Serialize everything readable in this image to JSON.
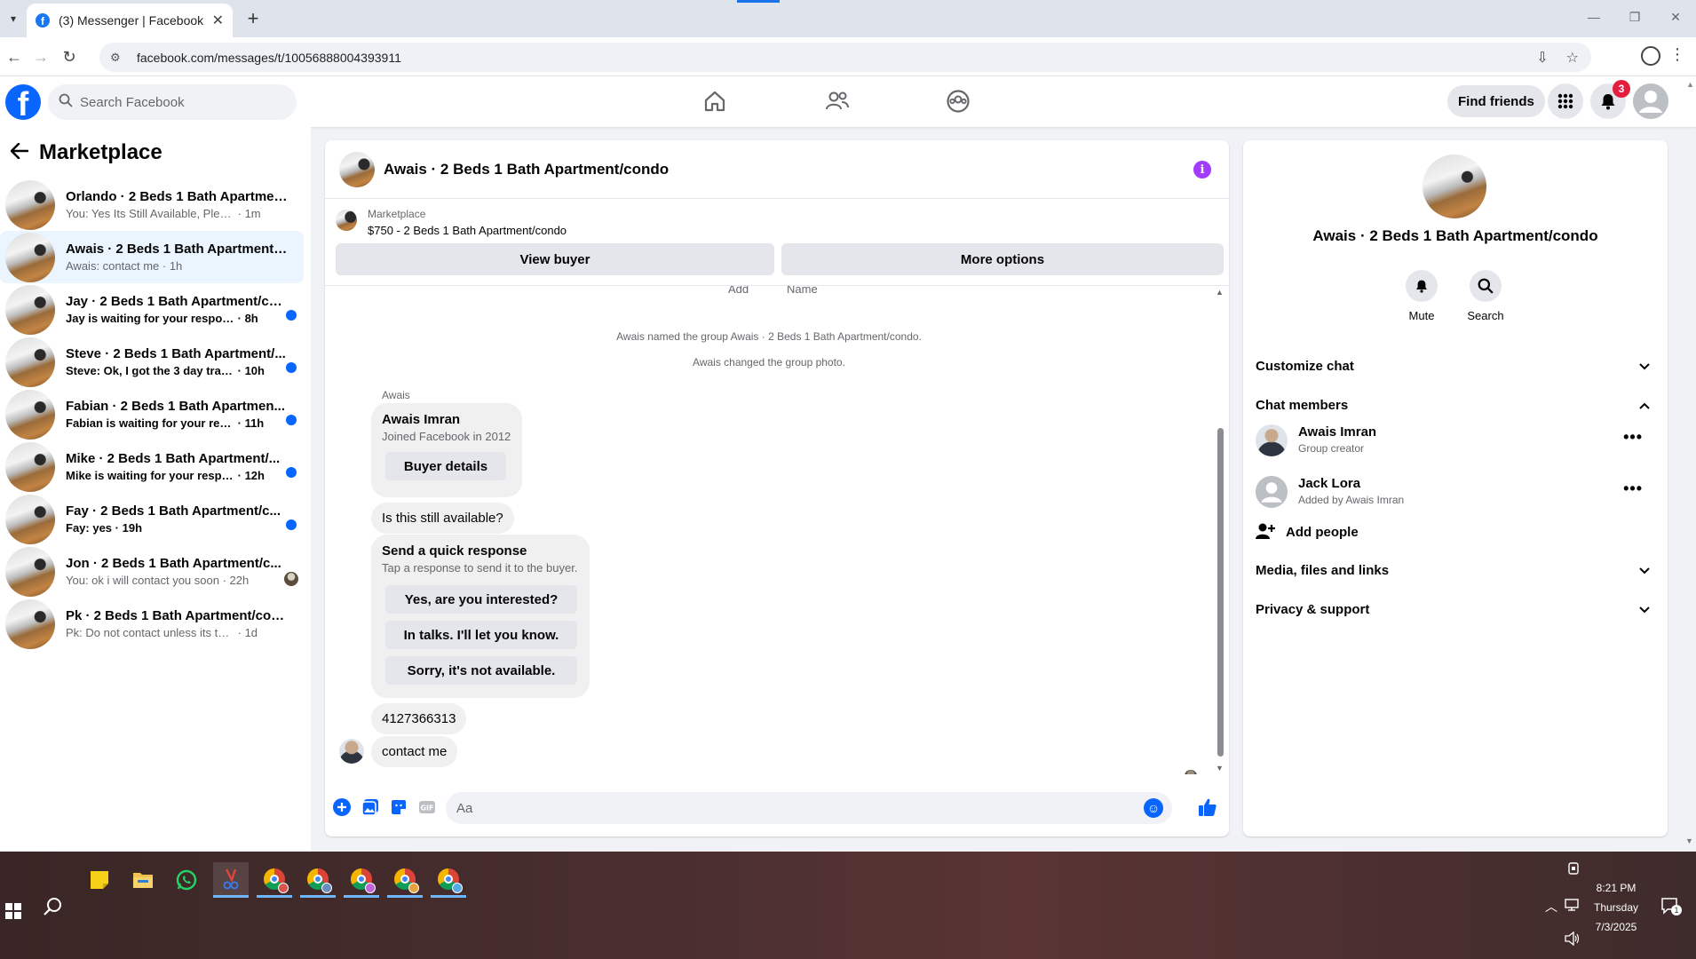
{
  "browser": {
    "tab_title": "(3) Messenger | Facebook",
    "url": "facebook.com/messages/t/10056888004393911"
  },
  "header": {
    "search_placeholder": "Search Facebook",
    "find_friends": "Find friends",
    "notification_count": "3"
  },
  "sidebar": {
    "title": "Marketplace",
    "conversations": [
      {
        "name": "Orlando · 2 Beds 1 Bath Apartment...",
        "preview": "You: Yes Its Still Available, Please Sen...",
        "time": "1m",
        "unread": false,
        "active": false
      },
      {
        "name": "Awais · 2 Beds 1 Bath Apartment/c...",
        "preview": "Awais: contact me",
        "time": "1h",
        "unread": false,
        "active": true
      },
      {
        "name": "Jay · 2 Beds 1 Bath Apartment/co...",
        "preview": "Jay is waiting for your response.",
        "time": "8h",
        "unread": true,
        "active": false
      },
      {
        "name": "Steve · 2 Beds 1 Bath Apartment/...",
        "preview": "Steve: Ok, I got the 3 day trail for ...",
        "time": "10h",
        "unread": true,
        "active": false
      },
      {
        "name": "Fabian · 2 Beds 1 Bath Apartmen...",
        "preview": "Fabian is waiting for your respon...",
        "time": "11h",
        "unread": true,
        "active": false
      },
      {
        "name": "Mike · 2 Beds 1 Bath Apartment/...",
        "preview": "Mike is waiting for your response.",
        "time": "12h",
        "unread": true,
        "active": false
      },
      {
        "name": "Fay · 2 Beds 1 Bath Apartment/c...",
        "preview": "Fay: yes",
        "time": "19h",
        "unread": true,
        "active": false
      },
      {
        "name": "Jon · 2 Beds 1 Bath Apartment/c...",
        "preview": "You: ok i will contact you soon",
        "time": "22h",
        "unread": false,
        "active": false
      },
      {
        "name": "Pk · 2 Beds 1 Bath Apartment/condo",
        "preview": "Pk: Do not contact unless its to do a v...",
        "time": "1d",
        "unread": false,
        "active": false
      }
    ]
  },
  "chat": {
    "title": "Awais · 2 Beds 1 Bath Apartment/condo",
    "listing_label": "Marketplace",
    "listing_price": "$750 - 2 Beds 1 Bath Apartment/condo",
    "view_buyer": "View buyer",
    "more_options": "More options",
    "cut_labels": [
      "Add",
      "Name"
    ],
    "system_messages": [
      "Awais named the group Awais · 2 Beds 1 Bath Apartment/condo.",
      "Awais changed the group photo."
    ],
    "sender": "Awais",
    "buyer_card": {
      "name": "Awais Imran",
      "sub": "Joined Facebook in 2012",
      "button": "Buyer details"
    },
    "msg_available": "Is this still available?",
    "quick_response": {
      "title": "Send a quick response",
      "sub": "Tap a response to send it to the buyer.",
      "options": [
        "Yes, are you interested?",
        "In talks. I'll let you know.",
        "Sorry, it's not available."
      ]
    },
    "msg_phone": "4127366313",
    "msg_contact": "contact me",
    "composer_placeholder": "Aa"
  },
  "info_panel": {
    "title": "Awais · 2 Beds 1 Bath Apartment/condo",
    "mute": "Mute",
    "search": "Search",
    "customize_chat": "Customize chat",
    "chat_members": "Chat members",
    "members": [
      {
        "name": "Awais Imran",
        "sub": "Group creator"
      },
      {
        "name": "Jack Lora",
        "sub": "Added by Awais Imran"
      }
    ],
    "add_people": "Add people",
    "media": "Media, files and links",
    "privacy": "Privacy & support"
  },
  "taskbar": {
    "time": "8:21 PM",
    "day": "Thursday",
    "date": "7/3/2025",
    "notification_count": "1"
  },
  "colors": {
    "fb_blue": "#0866ff",
    "active_conv": "#ebf5ff",
    "info_purple": "#a33bff",
    "badge_red": "#e41e3f"
  }
}
